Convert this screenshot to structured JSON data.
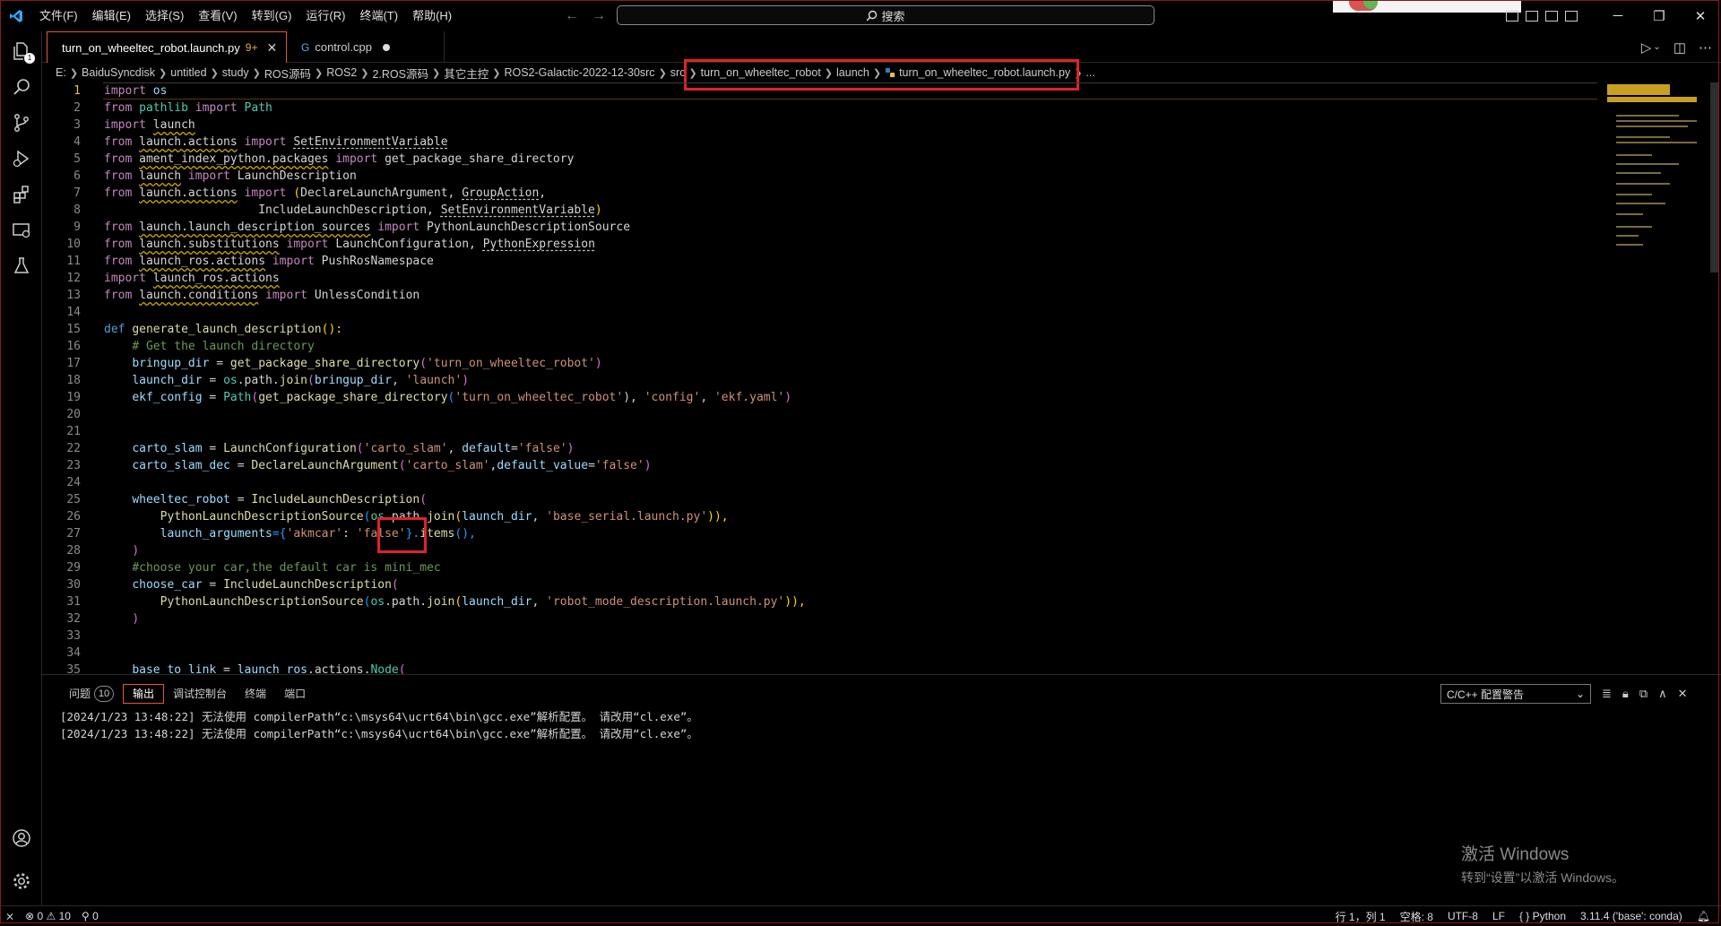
{
  "menu": [
    "文件(F)",
    "编辑(E)",
    "选择(S)",
    "查看(V)",
    "转到(G)",
    "运行(R)",
    "终端(T)",
    "帮助(H)"
  ],
  "search": {
    "label": "搜索"
  },
  "tabs": [
    {
      "label": "turn_on_wheeltec_robot.launch.py",
      "badge": "9+",
      "active": true
    },
    {
      "label": "control.cpp",
      "active": false
    }
  ],
  "breadcrumb": [
    "E:",
    "BaiduSyncdisk",
    "untitled",
    "study",
    "ROS源码",
    "ROS2",
    "2.ROS源码",
    "其它主控",
    "ROS2-Galactic-2022-12-30src",
    "src",
    "turn_on_wheeltec_robot",
    "launch",
    "turn_on_wheeltec_robot.launch.py",
    "..."
  ],
  "code_lines": [
    "1",
    "2",
    "3",
    "4",
    "5",
    "6",
    "7",
    "8",
    "9",
    "10",
    "11",
    "12",
    "13",
    "14",
    "15",
    "16",
    "17",
    "18",
    "19",
    "20",
    "21",
    "22",
    "23",
    "24",
    "25",
    "26",
    "27",
    "28",
    "29",
    "30",
    "31",
    "32",
    "33",
    "34",
    "35"
  ],
  "code": {
    "l1a": "import",
    "l1b": " os",
    "l2a": "from",
    "l2b": " pathlib ",
    "l2c": "import",
    "l2d": " Path",
    "l3a": "import",
    "l3b": "launch",
    "l4a": "from",
    "l4b": "launch.actions",
    "l4c": " import ",
    "l4d": "SetEnvironmentVariable",
    "l5a": "from",
    "l5b": "ament_index_python.packages",
    "l5c": " import ",
    "l5d": "get_package_share_directory",
    "l6a": "from",
    "l6b": "launch",
    "l6c": " import ",
    "l6d": "LaunchDescription",
    "l7a": "from",
    "l7b": "launch.actions",
    "l7c": " import ",
    "l7d": "(",
    "l7e": "DeclareLaunchArgument, ",
    "l7f": "GroupAction",
    ",": ",",
    "l8a": "IncludeLaunchDescription, ",
    "l8b": "SetEnvironmentVariable",
    "l8c": ")",
    "l9a": "from",
    "l9b": "launch.launch_description_sources",
    "l9c": " import ",
    "l9d": "PythonLaunchDescriptionSource",
    "l10a": "from",
    "l10b": "launch.substitutions",
    "l10c": " import ",
    "l10d": "LaunchConfiguration, ",
    "l10e": "PythonExpression",
    "l11a": "from",
    "l11b": "launch_ros.actions",
    "l11c": " import ",
    "l11d": "PushRosNamespace",
    "l12a": "import",
    "l12b": "launch_ros.actions",
    "l13a": "from",
    "l13b": "launch.conditions",
    "l13c": " import ",
    "l13d": "UnlessCondition",
    "l15a": "def",
    "l15b": "generate_launch_description",
    "l15c": "():",
    "l16": "# Get the launch directory",
    "l17a": "bringup_dir",
    " l17b": " = ",
    "l17c": "get_package_share_directory",
    "l17d": "(",
    "l17e": "'turn_on_wheeltec_robot'",
    "l17f": ")",
    "l18a": "launch_dir",
    "l18b": " = ",
    "l18c": "os",
    "l18d": ".path.",
    "l18e": "join",
    "l18f": "(",
    "l18g": "bringup_dir",
    ", ": ", ",
    "l18h": "'launch'",
    "l18i": ")",
    "l19a": "ekf_config",
    "l19b": " = ",
    "l19c": "Path",
    "l19d": "(",
    "l19e": "get_package_share_directory",
    "l19f": "(",
    "l19g": "'turn_on_wheeltec_robot'",
    "l19h": "), ",
    "l19i": "'config'",
    "l19j": ", ",
    "l19k": "'ekf.yaml'",
    "l19l": ")",
    "l22a": "carto_slam",
    "l22b": " = ",
    "l22c": "LaunchConfiguration",
    "l22d": "(",
    "l22e": "'carto_slam'",
    "l22f": ", ",
    "l22g": "default",
    "l22h": "=",
    "l22i": "'false'",
    "l22j": ")",
    "l23a": "carto_slam_dec",
    "l23b": " = ",
    "l23c": "DeclareLaunchArgument",
    "l23d": "(",
    "l23e": "'carto_slam'",
    "l23f": ",",
    "l23g": "default_value",
    "l23h": "=",
    "l23i": "'false'",
    "l23j": ")",
    "l25a": "wheeltec_robot",
    "l25b": " = ",
    "l25c": "IncludeLaunchDescription",
    "l25d": "(",
    "l26a": "PythonLaunchDescriptionSource",
    "l26b": "(",
    "l26c": "os",
    "l26d": ".path.",
    "l26e": "join",
    "l26f": "(",
    "l26g": "launch_dir",
    "l26h": "'base_serial.launch.py'",
    "l26i": ")),",
    "l27a": "launch_arguments",
    "l27b": "={",
    "l27c": "'akmcar'",
    "l27d": ": ",
    "l27e": "'false'",
    "l27f": "}.",
    "l27g": "items",
    "l27h": "(),",
    "l28": ")",
    "l29": "#choose your car,the default car is mini_mec",
    "l30a": "choose_car",
    "l30b": " = ",
    "l30c": "IncludeLaunchDescription",
    "l30d": "(",
    "l31a": "PythonLaunchDescriptionSource",
    "l31b": "(",
    "l31c": "os",
    "l31d": ".path.",
    "l31e": "join",
    "l31f": "(",
    "l31g": "launch_dir",
    "l31h": ", ",
    "l31i": "'robot_mode_description.launch.py'",
    "l31j": ")),",
    "l32": ")",
    "l35a": "base_to_link",
    "l35b": " = ",
    "l35c": "launch_ros",
    "l35d": ".actions.",
    "l35e": "Node",
    "l35f": "("
  },
  "panel": {
    "tabs": [
      "问题",
      "输出",
      "调试控制台",
      "终端",
      "端口"
    ],
    "problems_count": "10",
    "output_channel": "C/C++ 配置警告",
    "lines": [
      "[2024/1/23 13:48:22] 无法使用 compilerPath“c:\\msys64\\ucrt64\\bin\\gcc.exe”解析配置。 请改用“cl.exe”。",
      "[2024/1/23 13:48:22] 无法使用 compilerPath“c:\\msys64\\ucrt64\\bin\\gcc.exe”解析配置。 请改用“cl.exe”。"
    ]
  },
  "watermark": {
    "line1": "激活 Windows",
    "line2": "转到“设置”以激活 Windows。"
  },
  "status": {
    "errors": "0",
    "warnings": "10",
    "ports": "0",
    "position": "行 1，列 1",
    "spaces": "空格: 8",
    "encoding": "UTF-8",
    "eol": "LF",
    "language": "Python",
    "interpreter": "3.11.4 ('base': conda)"
  }
}
